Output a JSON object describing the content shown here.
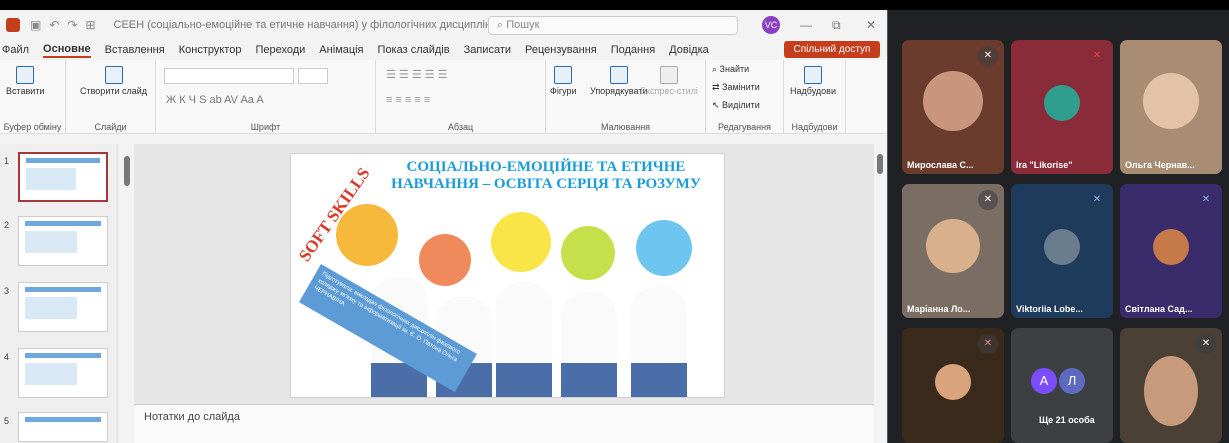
{
  "window": {
    "doc_title": "СЕЕН (соціально-емоційне та етичне навчання) у філологічних дисциплінах - PowerP...",
    "search_placeholder": "Пошук",
    "user_initials": "VC"
  },
  "menu": {
    "items": [
      "Файл",
      "Основне",
      "Вставлення",
      "Конструктор",
      "Переходи",
      "Анімація",
      "Показ слайдів",
      "Записати",
      "Рецензування",
      "Подання",
      "Довідка"
    ],
    "share_label": "Спільний доступ"
  },
  "ribbon": {
    "paste_label": "Вставити",
    "create_slide_label": "Створити слайд",
    "shapes_label": "Фігури",
    "arrange_label": "Упорядкувати",
    "express_label": "Експрес-стилі",
    "find_label": "Знайти",
    "replace_label": "Замінити",
    "select_label": "Виділити",
    "addins_label": "Надбудови",
    "groups": [
      "Буфер обміну",
      "Слайди",
      "Шрифт",
      "Абзац",
      "Малювання",
      "Редагування",
      "Надбудови"
    ]
  },
  "thumbnails": [
    "1",
    "2",
    "3",
    "4",
    "5"
  ],
  "slide": {
    "title": "СОЦІАЛЬНО-ЕМОЦІЙНЕ ТА ЕТИЧНЕ НАВЧАННЯ – ОСВІТА СЕРЦЯ ТА РОЗУМУ",
    "soft_skills": "SOFT SKILLS",
    "banner_text": "Підготувала: викладач філологічних дисциплін фахового коледжу зв'язку та інформатизації ім. Є. О. Патона Ольга ЧЕРНАВІНА"
  },
  "notes_placeholder": "Нотатки до слайда",
  "participants": [
    {
      "name": "Мирослава С...",
      "bg": "#6b3b2e"
    },
    {
      "name": "Ira \"Likorise\"",
      "bg": "#8a2b3a"
    },
    {
      "name": "Ольга Чернав...",
      "bg": "#a88c74"
    },
    {
      "name": "Маріанна Ло...",
      "bg": "#7a6e64"
    },
    {
      "name": "Viktoriia Lobe...",
      "bg": "#1f3b5c"
    },
    {
      "name": "Світлана Сад...",
      "bg": "#3a2c6b"
    },
    {
      "name": "",
      "bg": "#3a2a1c"
    },
    {
      "name": "Ще 21 особа",
      "bg": "#3c4043"
    },
    {
      "name": "",
      "bg": "#4a4036"
    }
  ],
  "more_avatars": [
    "А",
    "Л"
  ]
}
